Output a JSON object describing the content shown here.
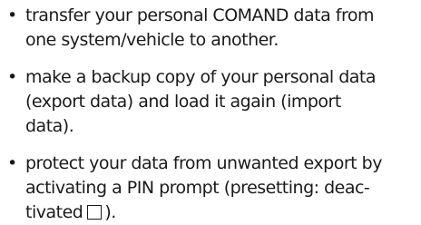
{
  "items": [
    {
      "bullet": "•",
      "lines": [
        "transfer your personal COMAND data from",
        "one system/vehicle to another."
      ]
    },
    {
      "bullet": "•",
      "lines": [
        "make a backup copy of your personal data",
        "(export data) and load it again (import",
        "data)."
      ]
    },
    {
      "bullet": "•",
      "lines": [
        "protect your data from unwanted export by",
        "activating a PIN prompt (presetting: deac-"
      ],
      "last_line_before_icon": "tivated",
      "last_line_after_icon": ").",
      "icon": "checkbox-unchecked-icon"
    }
  ]
}
